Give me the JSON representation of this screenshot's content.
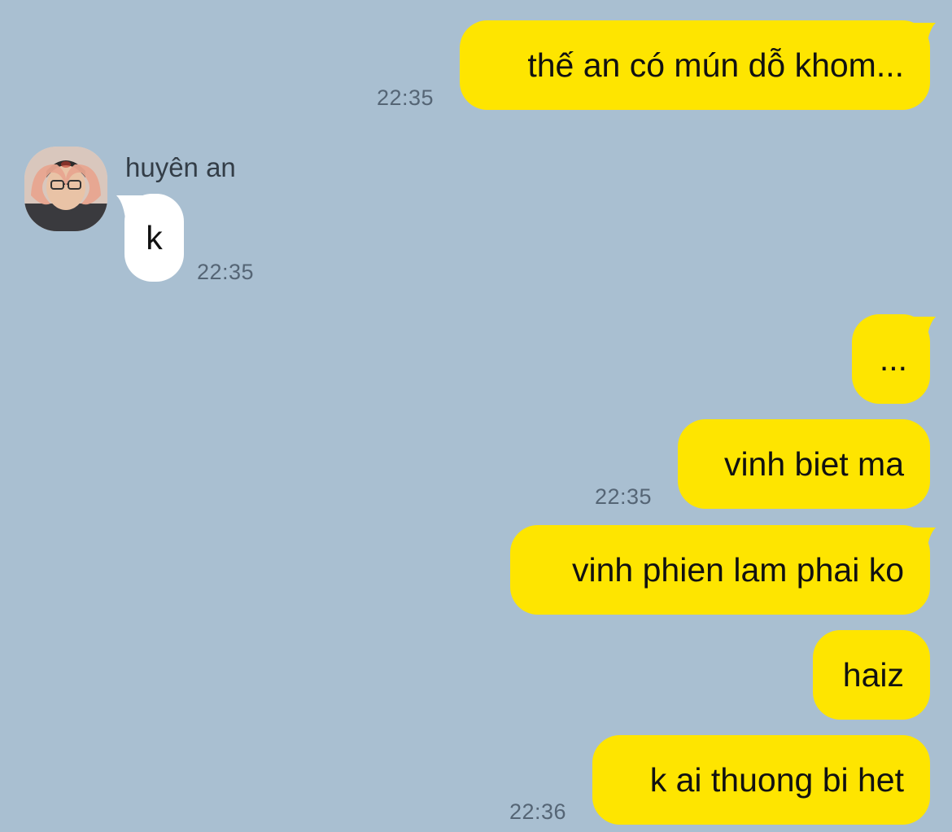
{
  "app": {
    "background_color": "#a9bfd1",
    "my_bubble_color": "#fee500",
    "their_bubble_color": "#ffffff"
  },
  "messages": [
    {
      "sender": "me",
      "text": "thế an có mún dỗ khom...",
      "time": "22:35"
    },
    {
      "sender": "huyên an",
      "avatar_icon": "profile-photo-heart-hands",
      "text": "k",
      "time": "22:35"
    },
    {
      "sender": "me",
      "text": "...",
      "time": ""
    },
    {
      "sender": "me",
      "text": "vinh biet ma",
      "time": "22:35"
    },
    {
      "sender": "me",
      "text": "vinh phien lam phai ko",
      "time": ""
    },
    {
      "sender": "me",
      "text": "haiz",
      "time": ""
    },
    {
      "sender": "me",
      "text": "k ai thuong bi het",
      "time": "22:36"
    }
  ]
}
